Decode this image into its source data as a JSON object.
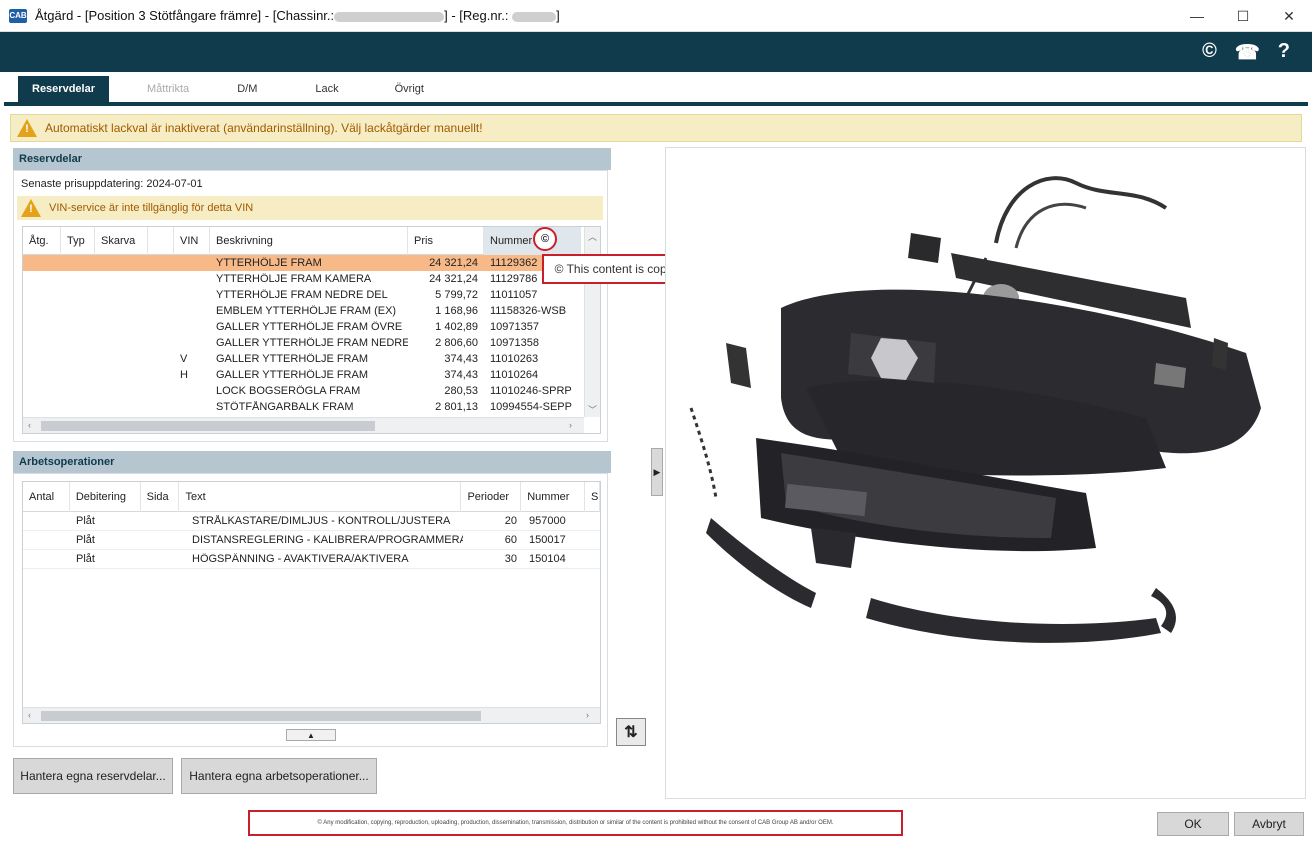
{
  "window": {
    "icon_text": "CAB",
    "title_part1": "Åtgärd - [Position 3 Stötfångare främre] - [Chassinr.:",
    "title_part2": "] - [Reg.nr.:",
    "title_part3": "]",
    "minimize_glyph": "—",
    "maximize_glyph": "☐",
    "close_glyph": "✕"
  },
  "header": {
    "copyright_glyph": "©",
    "phone_glyph": "☎",
    "help_glyph": "?"
  },
  "tabs": [
    {
      "label": "Reservdelar",
      "state": "active"
    },
    {
      "label": "Måttrikta",
      "state": "disabled"
    },
    {
      "label": "D/M",
      "state": "normal"
    },
    {
      "label": "Lack",
      "state": "normal"
    },
    {
      "label": "Övrigt",
      "state": "normal"
    }
  ],
  "banner": {
    "text": "Automatiskt lackval är inaktiverat (användarinställning). Välj lackåtgärder manuellt!"
  },
  "parts": {
    "section_title": "Reservdelar",
    "price_update": "Senaste prisuppdatering: 2024-07-01",
    "vin_warning": "VIN-service är inte tillgänglig för detta VIN",
    "columns": [
      "Åtg.",
      "Typ",
      "Skarva",
      "",
      "VIN",
      "Beskrivning",
      "Pris",
      "Nummer",
      "©"
    ],
    "rows": [
      {
        "vin": "",
        "desc": "YTTERHÖLJE FRAM",
        "price": "24 321,24",
        "number": "11129362",
        "selected": true
      },
      {
        "vin": "",
        "desc": "YTTERHÖLJE FRAM KAMERA",
        "price": "24 321,24",
        "number": "11129786"
      },
      {
        "vin": "",
        "desc": "YTTERHÖLJE FRAM NEDRE DEL",
        "price": "5 799,72",
        "number": "11011057"
      },
      {
        "vin": "",
        "desc": "EMBLEM YTTERHÖLJE FRAM (EX)",
        "price": "1 168,96",
        "number": "11158326-WSB"
      },
      {
        "vin": "",
        "desc": "GALLER YTTERHÖLJE FRAM ÖVRE",
        "price": "1 402,89",
        "number": "10971357"
      },
      {
        "vin": "",
        "desc": "GALLER YTTERHÖLJE FRAM NEDRE",
        "price": "2 806,60",
        "number": "10971358"
      },
      {
        "vin": "V",
        "desc": "GALLER YTTERHÖLJE FRAM",
        "price": "374,43",
        "number": "11010263"
      },
      {
        "vin": "H",
        "desc": "GALLER YTTERHÖLJE FRAM",
        "price": "374,43",
        "number": "11010264"
      },
      {
        "vin": "",
        "desc": "LOCK BOGSERÖGLA FRAM",
        "price": "280,53",
        "number": "11010246-SPRP"
      },
      {
        "vin": "",
        "desc": "STÖTFÅNGARBALK FRAM",
        "price": "2 801,13",
        "number": "10994554-SEPP"
      }
    ],
    "copyright_tooltip": "© This content is copyright protected by OEM."
  },
  "operations": {
    "section_title": "Arbetsoperationer",
    "columns": [
      "Antal",
      "Debitering",
      "Sida",
      "Text",
      "Perioder",
      "Nummer",
      "S"
    ],
    "rows": [
      {
        "antal": "",
        "debitering": "Plåt",
        "sida": "",
        "text": "STRÅLKASTARE/DIMLJUS - KONTROLL/JUSTERA",
        "perioder": "20",
        "nummer": "957000"
      },
      {
        "antal": "",
        "debitering": "Plåt",
        "sida": "",
        "text": "DISTANSREGLERING - KALIBRERA/PROGRAMMERA",
        "perioder": "60",
        "nummer": "150017"
      },
      {
        "antal": "",
        "debitering": "Plåt",
        "sida": "",
        "text": "HÖGSPÄNNING - AVAKTIVERA/AKTIVERA",
        "perioder": "30",
        "nummer": "150104"
      }
    ]
  },
  "buttons": {
    "manage_parts": "Hantera egna reservdelar...",
    "manage_operations": "Hantera egna arbetsoperationer...",
    "ok": "OK",
    "cancel": "Avbryt"
  },
  "legal": "© Any modification, copying, reproduction, uploading, production, dissemination, transmission, distribution or similar of the content is prohibited without the consent of CAB Group AB and/or OEM.",
  "colors": {
    "header_band": "#0f3b4d",
    "selected_row": "#f8b988",
    "warning_bg": "#f6edc4",
    "warning_text": "#a15a00",
    "highlight_border": "#c8202a"
  }
}
